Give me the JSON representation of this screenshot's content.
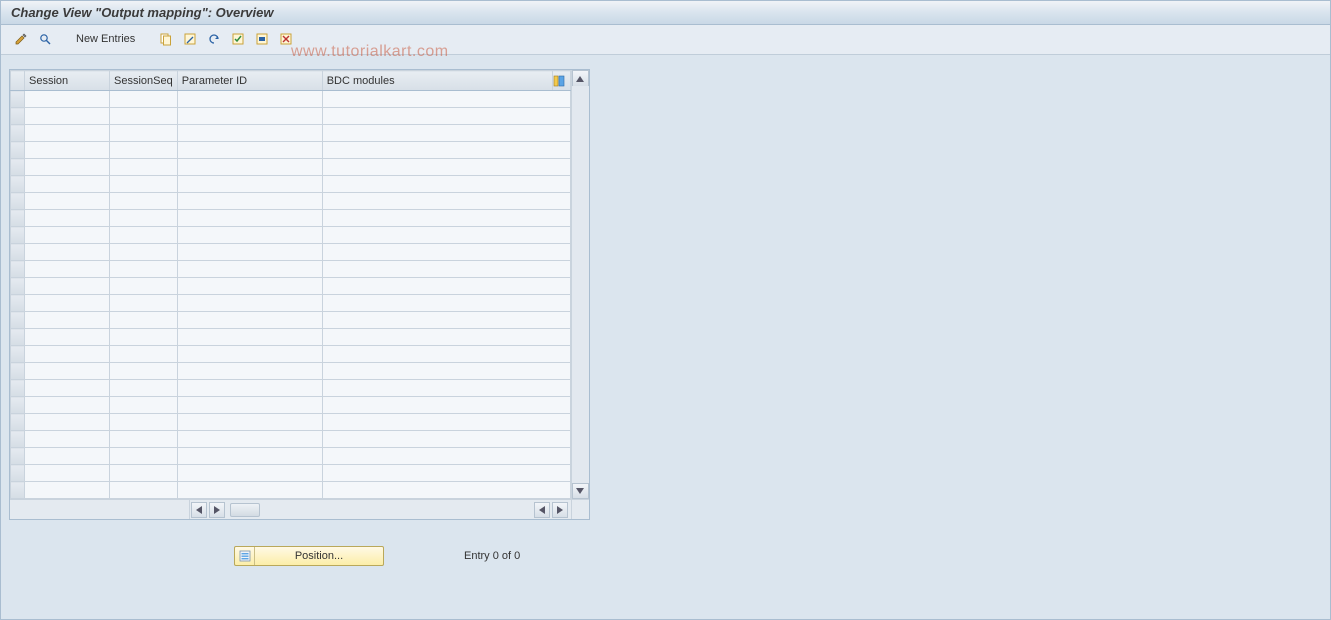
{
  "header": {
    "title": "Change View \"Output mapping\": Overview"
  },
  "toolbar": {
    "new_entries_label": "New Entries"
  },
  "watermark": "www.tutorialkart.com",
  "table": {
    "columns": {
      "session": "Session",
      "session_seq": "SessionSeq",
      "parameter_id": "Parameter ID",
      "bdc_modules": "BDC modules"
    },
    "rows": 24
  },
  "footer": {
    "position_label": "Position...",
    "entry_text": "Entry 0 of 0"
  }
}
